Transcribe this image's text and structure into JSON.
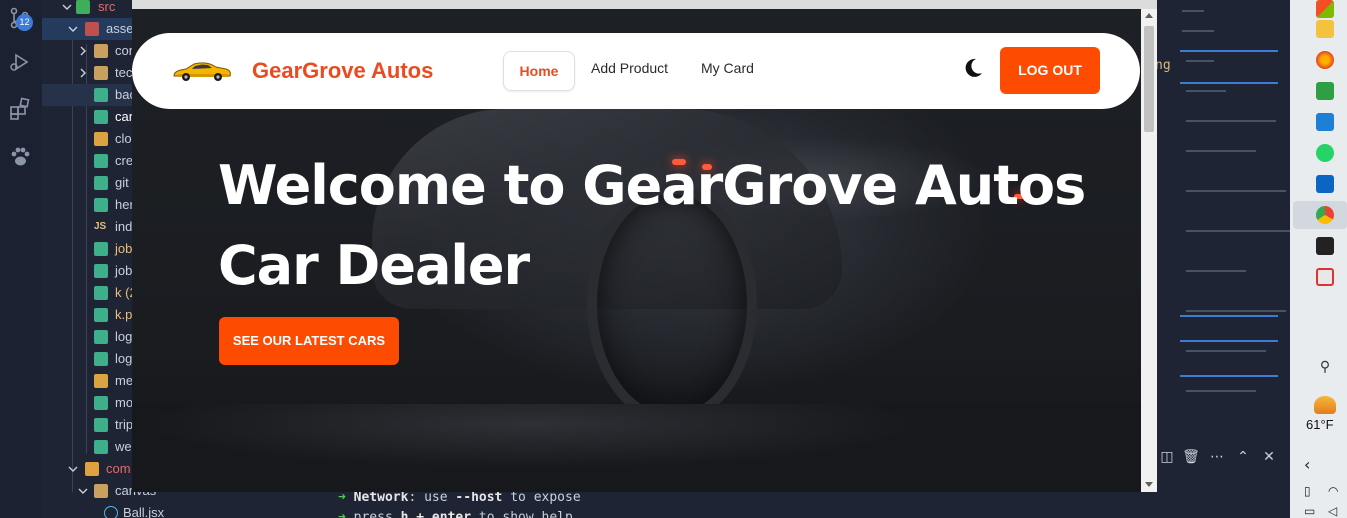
{
  "vscode": {
    "scm_badge": "12",
    "explorer": {
      "items": [
        {
          "label": "src"
        },
        {
          "label": "asse"
        },
        {
          "label": "cor"
        },
        {
          "label": "tec"
        },
        {
          "label": "bac"
        },
        {
          "label": "car"
        },
        {
          "label": "clo"
        },
        {
          "label": "cre"
        },
        {
          "label": "git"
        },
        {
          "label": "her"
        },
        {
          "label": "ind"
        },
        {
          "label": "job"
        },
        {
          "label": "job"
        },
        {
          "label": "k (2"
        },
        {
          "label": "k.p"
        },
        {
          "label": "log"
        },
        {
          "label": "log"
        },
        {
          "label": "me"
        },
        {
          "label": "mo"
        },
        {
          "label": "trip"
        },
        {
          "label": "we"
        },
        {
          "label": "com"
        },
        {
          "label": "canvas"
        },
        {
          "label": "Ball.jsx"
        }
      ]
    },
    "code_fragment": "ng",
    "terminal": {
      "line1_prefix": "➜",
      "line1_label": "Network",
      "line1_rest": ": use ",
      "line1_flag": "--host",
      "line1_tail": " to expose",
      "line2_prefix": "➜",
      "line2_text": "press ",
      "line2_key": "h + enter",
      "line2_tail": " to show help"
    }
  },
  "taskbar": {
    "weather": "61°F"
  },
  "site": {
    "brand": "GearGrove Autos",
    "nav": {
      "home": "Home",
      "add_product": "Add Product",
      "my_card": "My Card",
      "logout": "LOG OUT"
    },
    "hero": {
      "title_line1": "Welcome to GearGrove Autos",
      "title_line2": "Car Dealer",
      "cta": "SEE OUR LATEST CARS"
    },
    "colors": {
      "accent": "#fd4b02",
      "brand_text": "#ea4b1f"
    }
  }
}
